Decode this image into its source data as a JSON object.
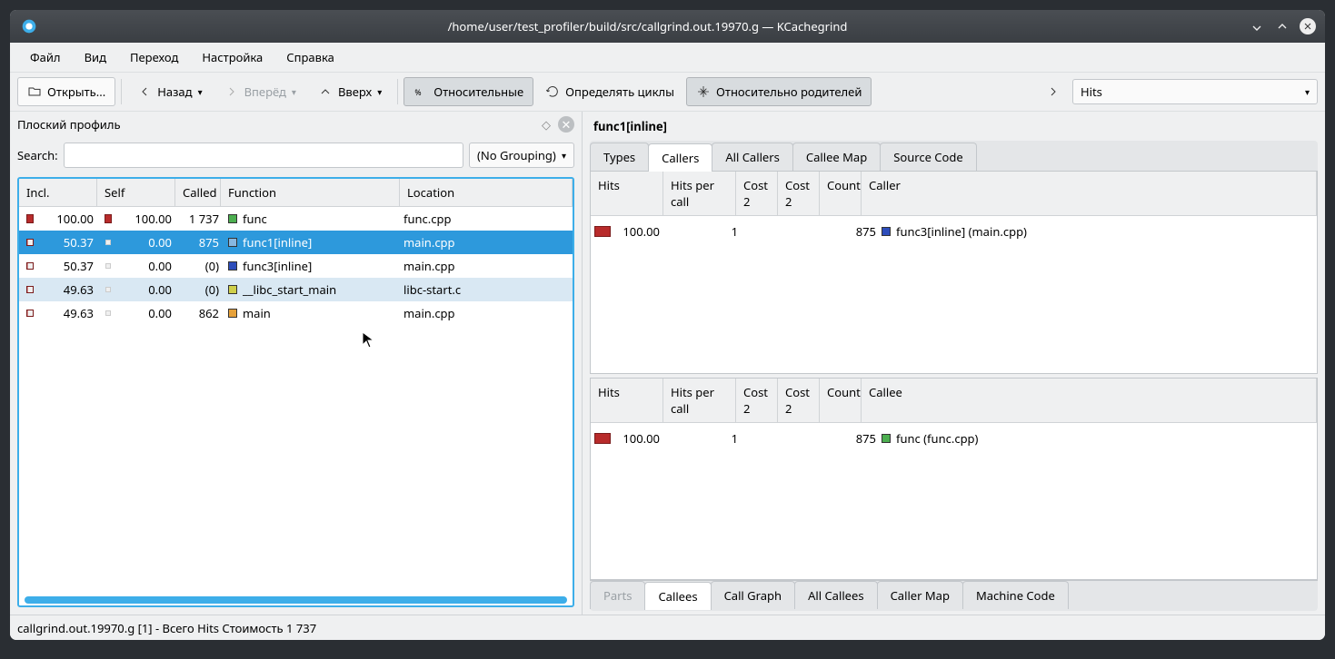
{
  "window": {
    "title": "/home/user/test_profiler/build/src/callgrind.out.19970.g — KCachegrind"
  },
  "menu": {
    "file": "Файл",
    "view": "Вид",
    "go": "Переход",
    "settings": "Настройка",
    "help": "Справка"
  },
  "toolbar": {
    "open": "Открыть...",
    "back": "Назад",
    "forward": "Вперёд",
    "up": "Вверх",
    "relative": "Относительные",
    "cycles": "Определять циклы",
    "parent_relative": "Относительно родителей",
    "cost_select": "Hits"
  },
  "left_panel": {
    "title": "Плоский профиль",
    "search_label": "Search:",
    "grouping": "(No Grouping)",
    "headers": {
      "incl": "Incl.",
      "self": "Self",
      "called": "Called",
      "func": "Function",
      "loc": "Location"
    },
    "rows": [
      {
        "incl": "100.00",
        "self": "100.00",
        "called": "1 737",
        "sq": "green",
        "func": "func",
        "loc": "func.cpp"
      },
      {
        "incl": "50.37",
        "self": "0.00",
        "called": "875",
        "sq": "lblue",
        "func": "func1[inline]",
        "loc": "main.cpp",
        "selected": true
      },
      {
        "incl": "50.37",
        "self": "0.00",
        "called": "(0)",
        "sq": "blue",
        "func": "func3[inline]",
        "loc": "main.cpp"
      },
      {
        "incl": "49.63",
        "self": "0.00",
        "called": "(0)",
        "sq": "yellow",
        "func": "__libc_start_main",
        "loc": "libc-start.c",
        "hover": true
      },
      {
        "incl": "49.63",
        "self": "0.00",
        "called": "862",
        "sq": "orange",
        "func": "main",
        "loc": "main.cpp"
      }
    ]
  },
  "right": {
    "header": "func1[inline]",
    "top_tabs": {
      "types": "Types",
      "callers": "Callers",
      "all_callers": "All Callers",
      "callee_map": "Callee Map",
      "source": "Source Code"
    },
    "callers": {
      "headers": {
        "hits": "Hits",
        "hpc": "Hits per call",
        "c2a": "Cost 2",
        "c2b": "Cost 2",
        "count": "Count",
        "caller": "Caller"
      },
      "rows": [
        {
          "hits": "100.00",
          "hpc": "1",
          "count": "875",
          "sq": "blue",
          "caller": "func3[inline] (main.cpp)"
        }
      ]
    },
    "callees_hdr": {
      "headers": {
        "hits": "Hits",
        "hpc": "Hits per call",
        "c2a": "Cost 2",
        "c2b": "Cost 2",
        "count": "Count",
        "callee": "Callee"
      },
      "rows": [
        {
          "hits": "100.00",
          "hpc": "1",
          "count": "875",
          "sq": "green",
          "callee": "func (func.cpp)"
        }
      ]
    },
    "bottom_tabs": {
      "parts": "Parts",
      "callees": "Callees",
      "call_graph": "Call Graph",
      "all_callees": "All Callees",
      "caller_map": "Caller Map",
      "machine_code": "Machine Code"
    }
  },
  "status": "callgrind.out.19970.g [1] - Всего Hits Стоимость 1 737"
}
